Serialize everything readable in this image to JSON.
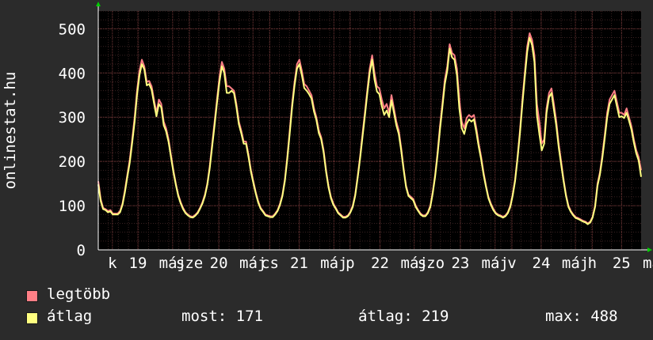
{
  "chart_data": {
    "type": "line",
    "ylabel": "onlinestat.hu",
    "ylim": [
      0,
      540
    ],
    "yticks": [
      0,
      100,
      200,
      300,
      400,
      500
    ],
    "x_tick_labels": [
      {
        "text": "k",
        "pos": 0.026
      },
      {
        "text": "19",
        "pos": 0.073
      },
      {
        "text": "máj",
        "pos": 0.137
      },
      {
        "text": "sze",
        "pos": 0.168
      },
      {
        "text": "20",
        "pos": 0.222
      },
      {
        "text": "máj",
        "pos": 0.285
      },
      {
        "text": "cs",
        "pos": 0.316
      },
      {
        "text": "21",
        "pos": 0.37
      },
      {
        "text": "máj",
        "pos": 0.434
      },
      {
        "text": "p",
        "pos": 0.464
      },
      {
        "text": "22",
        "pos": 0.519
      },
      {
        "text": "máj",
        "pos": 0.582
      },
      {
        "text": "szo",
        "pos": 0.613
      },
      {
        "text": "23",
        "pos": 0.667
      },
      {
        "text": "máj",
        "pos": 0.731
      },
      {
        "text": "v",
        "pos": 0.762
      },
      {
        "text": "24",
        "pos": 0.816
      },
      {
        "text": "máj",
        "pos": 0.879
      },
      {
        "text": "h",
        "pos": 0.91
      },
      {
        "text": "25",
        "pos": 0.964
      },
      {
        "text": "máj",
        "pos": 1.028
      }
    ],
    "series": [
      {
        "name": "legtöbb",
        "color": "#ff7f86",
        "values": [
          155,
          115,
          95,
          92,
          88,
          90,
          82,
          82,
          82,
          88,
          105,
          135,
          170,
          205,
          250,
          300,
          360,
          405,
          430,
          415,
          380,
          382,
          370,
          340,
          310,
          340,
          330,
          290,
          275,
          250,
          215,
          180,
          150,
          125,
          108,
          95,
          85,
          80,
          76,
          75,
          79,
          85,
          95,
          108,
          125,
          150,
          190,
          240,
          290,
          340,
          390,
          425,
          410,
          370,
          370,
          365,
          360,
          330,
          290,
          270,
          245,
          245,
          215,
          180,
          155,
          130,
          110,
          95,
          88,
          80,
          78,
          76,
          76,
          82,
          90,
          105,
          125,
          160,
          210,
          270,
          330,
          380,
          420,
          430,
          405,
          375,
          370,
          360,
          350,
          320,
          300,
          270,
          255,
          225,
          180,
          145,
          120,
          105,
          95,
          85,
          80,
          75,
          75,
          78,
          86,
          100,
          125,
          165,
          210,
          260,
          310,
          360,
          410,
          440,
          400,
          370,
          365,
          340,
          320,
          330,
          310,
          350,
          320,
          290,
          270,
          230,
          185,
          145,
          125,
          120,
          115,
          100,
          90,
          82,
          78,
          78,
          85,
          100,
          130,
          170,
          220,
          280,
          330,
          385,
          415,
          465,
          445,
          440,
          410,
          340,
          290,
          275,
          298,
          305,
          300,
          305,
          275,
          240,
          210,
          175,
          145,
          120,
          105,
          93,
          84,
          80,
          78,
          75,
          78,
          85,
          100,
          125,
          160,
          210,
          270,
          340,
          400,
          460,
          490,
          475,
          440,
          330,
          290,
          240,
          250,
          320,
          355,
          365,
          330,
          290,
          240,
          200,
          160,
          125,
          100,
          88,
          80,
          74,
          72,
          69,
          66,
          64,
          60,
          64,
          75,
          100,
          150,
          175,
          215,
          260,
          310,
          340,
          350,
          360,
          335,
          310,
          310,
          305,
          320,
          300,
          280,
          250,
          225,
          210,
          180
        ]
      },
      {
        "name": "átlag",
        "color": "#ffff80",
        "values": [
          148,
          110,
          92,
          90,
          85,
          87,
          80,
          80,
          80,
          85,
          102,
          130,
          165,
          198,
          242,
          290,
          350,
          395,
          420,
          408,
          372,
          375,
          362,
          332,
          302,
          330,
          322,
          282,
          268,
          244,
          210,
          176,
          147,
          122,
          105,
          92,
          83,
          78,
          74,
          73,
          77,
          83,
          93,
          105,
          122,
          147,
          185,
          233,
          282,
          332,
          380,
          415,
          400,
          355,
          355,
          360,
          354,
          323,
          284,
          264,
          240,
          240,
          210,
          176,
          151,
          127,
          107,
          93,
          86,
          78,
          76,
          74,
          74,
          80,
          88,
          102,
          122,
          156,
          205,
          263,
          322,
          372,
          410,
          420,
          395,
          366,
          360,
          352,
          342,
          313,
          294,
          264,
          250,
          220,
          176,
          142,
          117,
          102,
          93,
          83,
          78,
          73,
          73,
          76,
          84,
          97,
          122,
          161,
          205,
          253,
          302,
          352,
          400,
          430,
          385,
          358,
          352,
          325,
          305,
          315,
          300,
          338,
          310,
          282,
          262,
          224,
          181,
          142,
          122,
          117,
          112,
          97,
          88,
          80,
          76,
          76,
          83,
          97,
          127,
          166,
          214,
          272,
          322,
          375,
          405,
          455,
          435,
          430,
          395,
          320,
          275,
          262,
          285,
          295,
          290,
          295,
          266,
          233,
          204,
          170,
          142,
          117,
          102,
          90,
          82,
          78,
          76,
          73,
          76,
          83,
          97,
          122,
          156,
          205,
          263,
          330,
          390,
          448,
          480,
          463,
          425,
          305,
          262,
          225,
          240,
          310,
          345,
          355,
          318,
          280,
          232,
          193,
          156,
          122,
          97,
          86,
          78,
          72,
          70,
          67,
          64,
          62,
          58,
          62,
          73,
          97,
          145,
          170,
          208,
          252,
          300,
          330,
          340,
          350,
          325,
          300,
          302,
          298,
          310,
          292,
          272,
          243,
          218,
          202,
          165
        ]
      }
    ],
    "legend": [
      {
        "label": "legtöbb",
        "color": "#ff7f86"
      },
      {
        "label": "átlag",
        "color": "#ffff80"
      }
    ],
    "legend_placement": "bottom-left",
    "grid": true,
    "stats": {
      "most": "most: 171",
      "atlag": "átlag: 219",
      "max": "max: 488"
    }
  }
}
